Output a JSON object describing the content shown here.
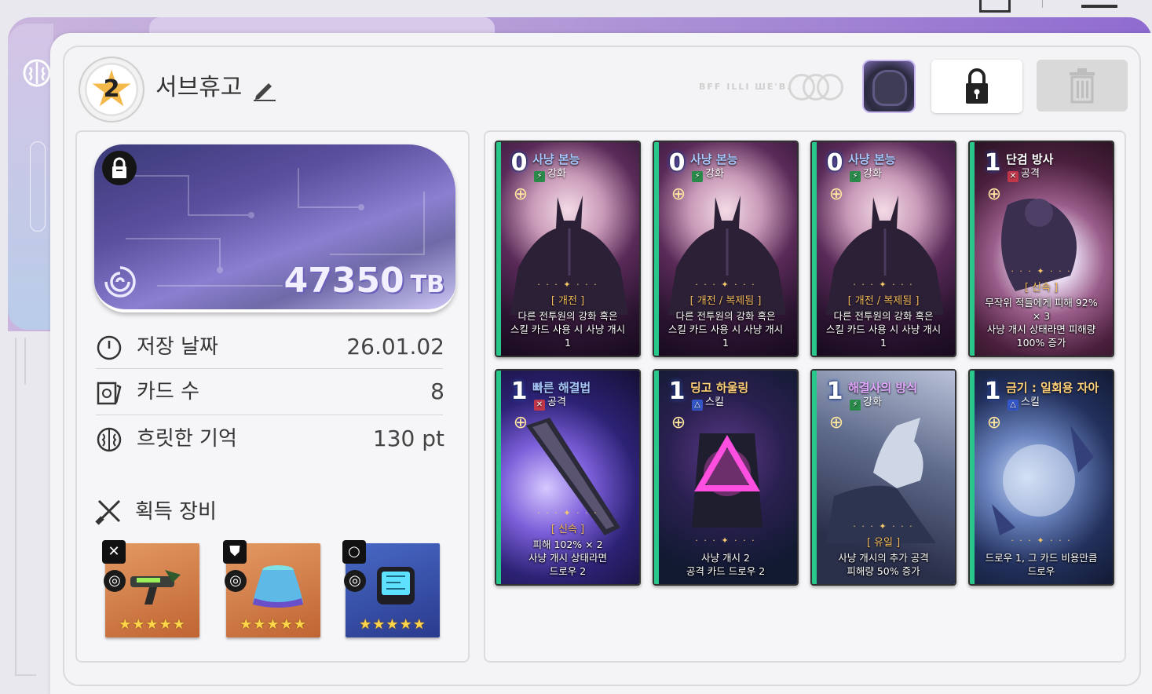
{
  "header": {
    "rank": "2",
    "title": "서브휴고",
    "faded_text": "BFF ILLI ШЕ'В."
  },
  "storage": {
    "value": "47350",
    "unit": "TB"
  },
  "info": {
    "date_label": "저장 날짜",
    "date_value": "26.01.02",
    "cards_label": "카드 수",
    "cards_value": "8",
    "memory_label": "흐릿한 기억",
    "memory_value": "130 pt"
  },
  "equipment": {
    "title": "획득 장비",
    "items": [
      {
        "slot_icon": "crossed-swords-icon",
        "stars": "★★★★★",
        "theme": "orange"
      },
      {
        "slot_icon": "armor-icon",
        "stars": "★★★★★",
        "theme": "orange"
      },
      {
        "slot_icon": "ring-icon",
        "stars": "★★★★★",
        "theme": "blue"
      }
    ]
  },
  "cards": [
    {
      "cost": "0",
      "name": "사냥 본능",
      "name_color": "#a9c8ff",
      "type": "강화",
      "type_icon": "bolt",
      "keyword": "[ 개전 ]",
      "desc": [
        "다른 전투원의 강화 혹은",
        "스킬 카드 사용 시 사냥 개시",
        "1"
      ],
      "theme": "moon"
    },
    {
      "cost": "0",
      "name": "사냥 본능",
      "name_color": "#a9c8ff",
      "type": "강화",
      "type_icon": "bolt",
      "keyword": "[ 개전 / 복제됨 ]",
      "desc": [
        "다른 전투원의 강화 혹은",
        "스킬 카드 사용 시 사냥 개시",
        "1"
      ],
      "theme": "moon"
    },
    {
      "cost": "0",
      "name": "사냥 본능",
      "name_color": "#a9c8ff",
      "type": "강화",
      "type_icon": "bolt",
      "keyword": "[ 개전 / 복제됨 ]",
      "desc": [
        "다른 전투원의 강화 혹은",
        "스킬 카드 사용 시 사냥 개시",
        "1"
      ],
      "theme": "moon"
    },
    {
      "cost": "1",
      "name": "단검 방사",
      "name_color": "#ffffff",
      "type": "공격",
      "type_icon": "cross",
      "keyword": "[ 신속 ]",
      "desc": [
        "무작위 적들에게 피해 92%",
        "× 3",
        "사냥 개시 상태라면 피해량",
        "100% 증가"
      ],
      "theme": "burst"
    },
    {
      "cost": "1",
      "name": "빠른 해결법",
      "name_color": "#a9c8ff",
      "type": "공격",
      "type_icon": "cross",
      "keyword": "[ 신속 ]",
      "desc": [
        "피해 102% × 2",
        "사냥 개시 상태라면",
        "드로우 2"
      ],
      "theme": "blade"
    },
    {
      "cost": "1",
      "name": "딩고 하울링",
      "name_color": "#ffd07a",
      "type": "스킬",
      "type_icon": "tri",
      "keyword": "",
      "desc": [
        "사냥 개시 2",
        "공격 카드 드로우 2"
      ],
      "theme": "neon"
    },
    {
      "cost": "1",
      "name": "해결사의 방식",
      "name_color": "#e3a8ff",
      "type": "강화",
      "type_icon": "bolt",
      "keyword": "[ 유일 ]",
      "desc": [
        "사냥 개시의 추가 공격",
        "피해량 50% 증가"
      ],
      "theme": "wolf"
    },
    {
      "cost": "1",
      "name": "금기 : 일회용 자아",
      "name_color": "#ffd07a",
      "type": "스킬",
      "type_icon": "tri",
      "keyword": "",
      "desc": [
        "드로우 1, 그 카드 비용만큼",
        "드로우"
      ],
      "theme": "crystal"
    }
  ],
  "colors": {
    "accent_purple": "#8f6bd0",
    "panel_bg": "#f4f4f6",
    "gold": "#f0b85a"
  }
}
